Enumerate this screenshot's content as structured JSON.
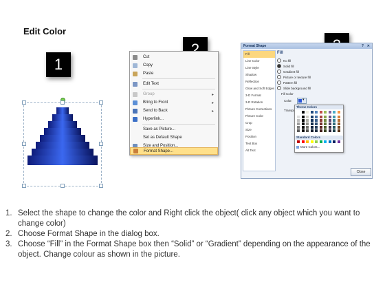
{
  "title": "Edit Color",
  "steps": {
    "one": "1",
    "two": "2",
    "three": "3"
  },
  "context_menu": {
    "items": [
      "Cut",
      "Copy",
      "Paste",
      "Edit Text",
      "Group",
      "Bring to Front",
      "Send to Back",
      "Hyperlink...",
      "Save as Picture...",
      "Set as Default Shape",
      "Size and Position...",
      "Format Shape..."
    ]
  },
  "format_dialog": {
    "title": "Format Shape",
    "sidebar": [
      "Fill",
      "Line Color",
      "Line Style",
      "Shadow",
      "Reflection",
      "Glow and Soft Edges",
      "3-D Format",
      "3-D Rotation",
      "Picture Corrections",
      "Picture Color",
      "Crop",
      "Size",
      "Position",
      "Text Box",
      "Alt Text"
    ],
    "fill_heading": "Fill",
    "options": [
      "No fill",
      "Solid fill",
      "Gradient fill",
      "Picture or texture fill",
      "Pattern fill",
      "Slide background fill"
    ],
    "fill_color_label": "Fill Color",
    "color_label": "Color:",
    "transparency_label": "Transpa",
    "theme_colors_label": "Theme Colors",
    "standard_colors_label": "Standard Colors",
    "more_colors_label": "More Colors...",
    "close_label": "Close"
  },
  "instructions": [
    {
      "num": "1.",
      "text": "Select the shape to change the color and Right click the object( click any object which you want to change color)"
    },
    {
      "num": "2.",
      "text": "Choose Format Shape in the dialog box."
    },
    {
      "num": "3.",
      "text": "Choose “Fill” in the Format Shape box then “Solid” or “Gradient” depending on the appearance of the object. Change colour as shown in the picture."
    }
  ],
  "colors": {
    "pyramid_blue": "#2b55d8",
    "menu_highlight": "#ffe08a",
    "sidebar_selected": "#fcd77e"
  }
}
